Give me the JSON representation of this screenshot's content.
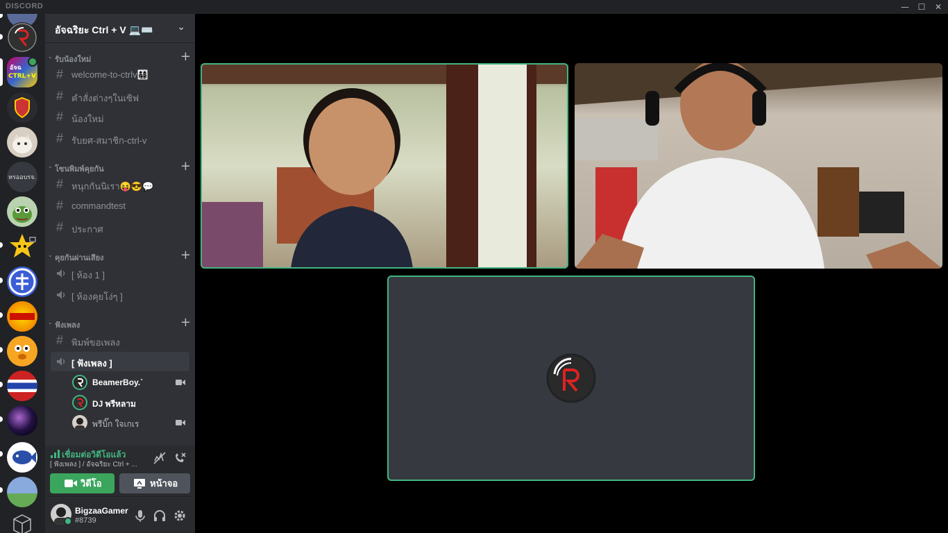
{
  "app": {
    "brand": "DISCORD"
  },
  "window_controls": {
    "minimize": "—",
    "maximize": "☐",
    "close": "✕"
  },
  "server": {
    "name": "อัจฉริยะ Ctrl + V 💻⌨️"
  },
  "categories": [
    {
      "label": "รับน้องใหม่",
      "channels": [
        {
          "type": "text",
          "name": "welcome-to-ctrlv👨‍👩‍👧‍👦"
        },
        {
          "type": "text",
          "name": "คำสั่งต่างๆในเซิฟ"
        },
        {
          "type": "text",
          "name": "น้องใหม่"
        },
        {
          "type": "text",
          "name": "รับยศ-สมาชิก-ctrl-v"
        }
      ]
    },
    {
      "label": "โซนพิมพ์คุยกัน",
      "channels": [
        {
          "type": "text",
          "name": "หนุกกันนิเรา😝😎💬"
        },
        {
          "type": "text",
          "name": "commandtest"
        },
        {
          "type": "text",
          "name": "ประกาศ"
        }
      ]
    },
    {
      "label": "คุยกันผ่านเสียง",
      "channels": [
        {
          "type": "voice",
          "name": "[ ห้อง 1 ]"
        },
        {
          "type": "voice",
          "name": "[ ห้องคุยโง่ๆ ]"
        }
      ]
    },
    {
      "label": "ฟังเพลง",
      "channels": [
        {
          "type": "text",
          "name": "พิมพ์ขอเพลง"
        },
        {
          "type": "voice",
          "name": "[ ฟังเพลง ]"
        }
      ]
    }
  ],
  "voice_users": [
    {
      "name": "BeamerBoy.`",
      "camera": true
    },
    {
      "name": "DJ พรีหลาม",
      "camera": false
    },
    {
      "name": "พรีบิ๊ก ใจเกเร",
      "camera": true
    }
  ],
  "voice_panel": {
    "status": "เชื่อมต่อวิดีโอแล้ว",
    "location": "[ ฟังเพลง ] / อัจฉริยะ Ctrl + ...",
    "video_button": "วิดีโอ",
    "screen_button": "หน้าจอ"
  },
  "user": {
    "name": "BigzaaGamer",
    "tag": "#8739"
  },
  "guild_names": [
    "",
    "",
    "อัจฉริยะ Ctrl+V",
    "",
    "",
    "หรออบรจ.",
    "",
    "",
    "",
    "",
    "",
    "",
    "",
    "",
    "",
    ""
  ],
  "guild_label_text": "หรออบรจ.",
  "colors": {
    "accent_green": "#43b581",
    "video_button": "#3ba55d",
    "screen_button": "#4f545c",
    "sidebar": "#2f3136",
    "guild_bar": "#202225"
  }
}
